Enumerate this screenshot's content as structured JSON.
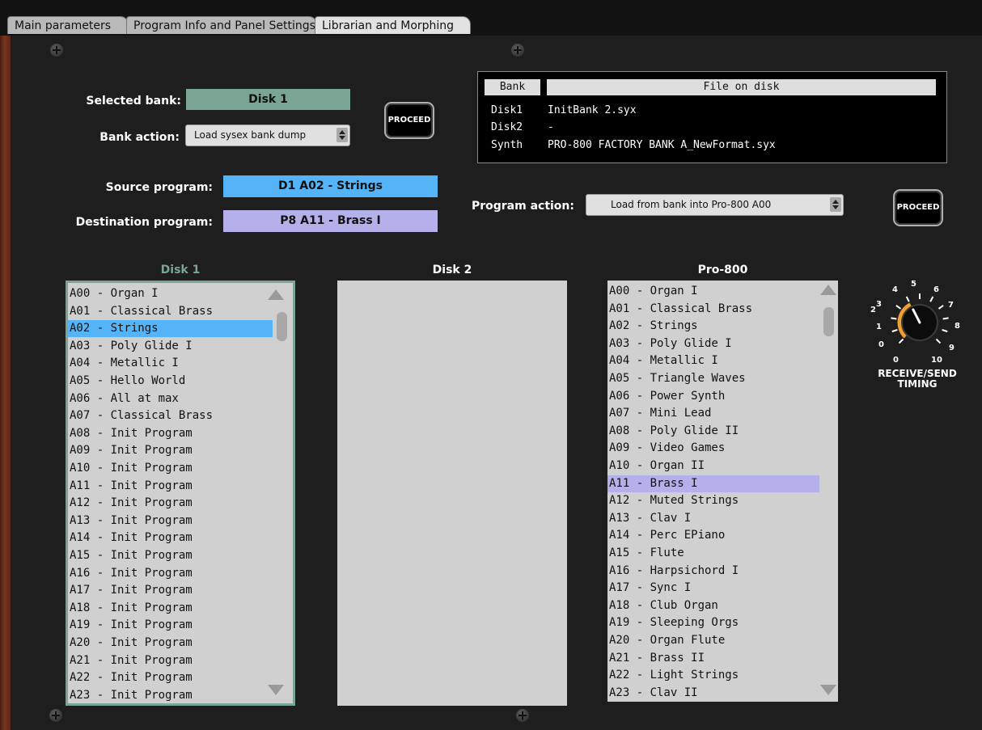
{
  "tabs": [
    {
      "label": "Main parameters"
    },
    {
      "label": "Program Info and Panel Settings"
    },
    {
      "label": "Librarian and Morphing"
    }
  ],
  "bank": {
    "selected_label": "Selected bank:",
    "selected_value": "Disk 1",
    "action_label": "Bank action:",
    "action_value": "Load sysex bank dump",
    "proceed_label": "PROCEED"
  },
  "file_table": {
    "head_bank": "Bank",
    "head_file": "File on disk",
    "rows": [
      {
        "bank": "Disk1",
        "file": "InitBank 2.syx"
      },
      {
        "bank": "Disk2",
        "file": "-"
      },
      {
        "bank": "Synth",
        "file": "PRO-800 FACTORY BANK A_NewFormat.syx"
      }
    ]
  },
  "program": {
    "source_label": "Source program:",
    "source_value": "D1 A02 - Strings",
    "dest_label": "Destination program:",
    "dest_value": "P8 A11 - Brass I",
    "action_label": "Program action:",
    "action_value": "Load from bank into Pro-800 A00",
    "proceed_label": "PROCEED"
  },
  "columns": {
    "disk1": "Disk 1",
    "disk2": "Disk 2",
    "pro800": "Pro-800"
  },
  "disk1_list": [
    "A00 - Organ I",
    "A01 - Classical Brass",
    "A02 - Strings",
    "A03 - Poly Glide I",
    "A04 - Metallic I",
    "A05 - Hello World",
    "A06 - All at max",
    "A07 - Classical Brass",
    "A08 - Init Program",
    "A09 - Init Program",
    "A10 - Init Program",
    "A11 - Init Program",
    "A12 - Init Program",
    "A13 - Init Program",
    "A14 - Init Program",
    "A15 - Init Program",
    "A16 - Init Program",
    "A17 - Init Program",
    "A18 - Init Program",
    "A19 - Init Program",
    "A20 - Init Program",
    "A21 - Init Program",
    "A22 - Init Program",
    "A23 - Init Program"
  ],
  "disk1_selected": 2,
  "pro800_list": [
    "A00 - Organ I",
    "A01 - Classical Brass",
    "A02 - Strings",
    "A03 - Poly Glide I",
    "A04 - Metallic I",
    "A05 - Triangle Waves",
    "A06 - Power Synth",
    "A07 - Mini Lead",
    "A08 - Poly Glide II",
    "A09 - Video Games",
    "A10 - Organ II",
    "A11 - Brass I",
    "A12 - Muted Strings",
    "A13 - Clav I",
    "A14 - Perc EPiano",
    "A15 - Flute",
    "A16 - Harpsichord I",
    "A17 - Sync I",
    "A18 - Club Organ",
    "A19 - Sleeping Orgs",
    "A20 - Organ Flute",
    "A21 - Brass II",
    "A22 - Light Strings",
    "A23 - Clav II"
  ],
  "pro800_selected": 11,
  "knob": {
    "label_line1": "RECEIVE/SEND",
    "label_line2": "TIMING",
    "scale": [
      "0",
      "1",
      "2",
      "3",
      "4",
      "5",
      "6",
      "7",
      "8",
      "9",
      "10"
    ],
    "value": 4
  },
  "colors": {
    "disk1_accent": "#7aa594",
    "source_blue": "#55b4f8",
    "dest_purple": "#b4b0ea",
    "knob_arc": "#f0a030"
  }
}
